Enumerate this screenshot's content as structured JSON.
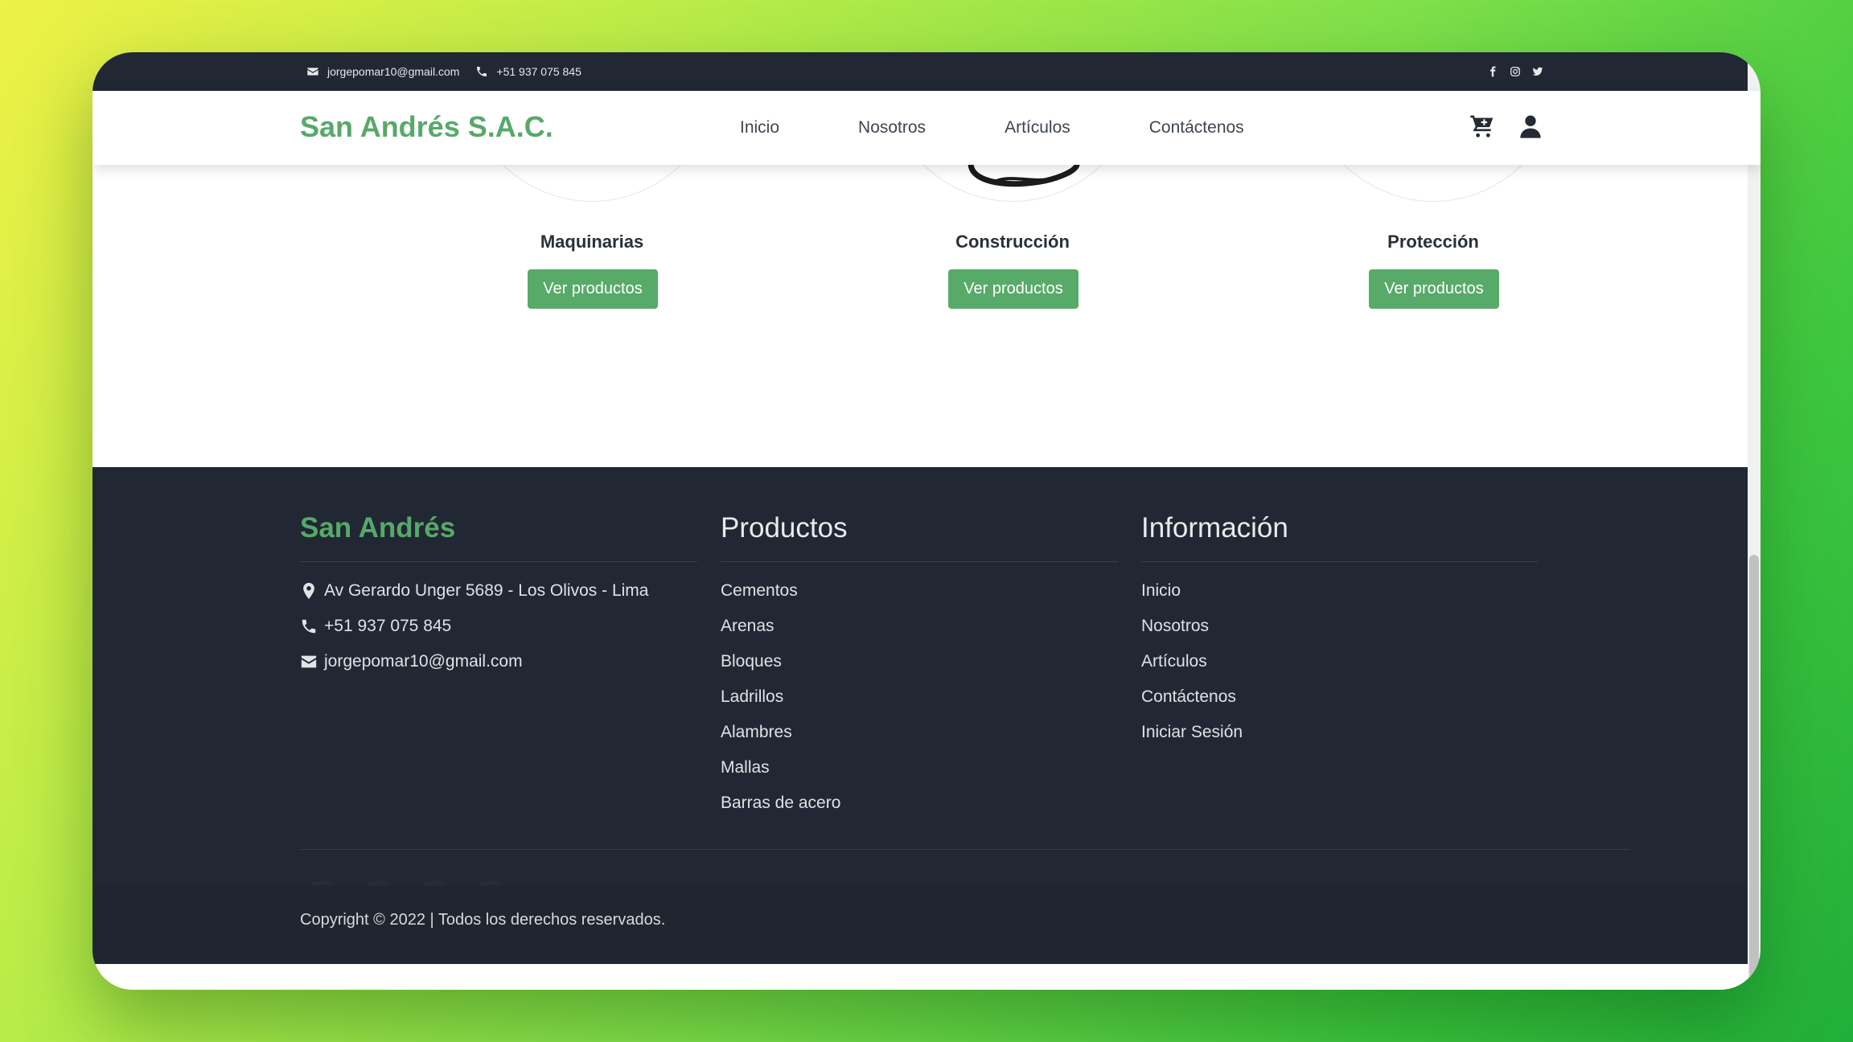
{
  "topbar": {
    "email": "jorgepomar10@gmail.com",
    "phone": "+51 937 075 845",
    "icons": [
      "mail-icon",
      "phone-icon",
      "facebook-icon",
      "instagram-icon",
      "twitter-icon"
    ]
  },
  "navbar": {
    "brand": "San Andrés S.A.C.",
    "links": [
      "Inicio",
      "Nosotros",
      "Artículos",
      "Contáctenos"
    ],
    "icons": [
      "cart-icon",
      "user-icon"
    ]
  },
  "categories": [
    {
      "title": "Maquinarias",
      "button": "Ver productos"
    },
    {
      "title": "Construcción",
      "button": "Ver productos"
    },
    {
      "title": "Protección",
      "button": "Ver productos"
    }
  ],
  "footer": {
    "brand": "San Andrés",
    "address": "Av Gerardo Unger 5689 - Los Olivos - Lima",
    "phone": "+51 937 075 845",
    "email": "jorgepomar10@gmail.com",
    "products_title": "Productos",
    "products": [
      "Cementos",
      "Arenas",
      "Bloques",
      "Ladrillos",
      "Alambres",
      "Mallas",
      "Barras de acero"
    ],
    "info_title": "Información",
    "info": [
      "Inicio",
      "Nosotros",
      "Artículos",
      "Contáctenos",
      "Iniciar Sesión"
    ],
    "social_icons": [
      "facebook-icon",
      "instagram-icon",
      "twitter-icon",
      "linkedin-icon"
    ],
    "copyright": "Copyright © 2022 | Todos los derechos reservados."
  },
  "colors": {
    "brand_green": "#57a96a",
    "dark": "#212833",
    "button_green": "#58aa69"
  }
}
